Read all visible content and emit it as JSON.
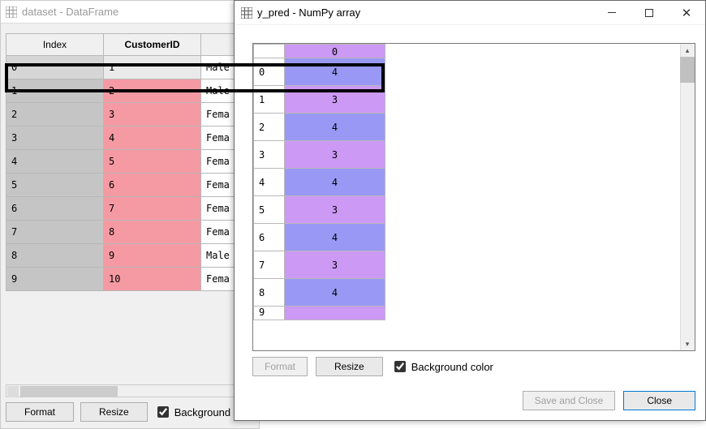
{
  "back_window": {
    "title": "dataset - DataFrame",
    "columns": {
      "index": "Index",
      "customer_id": "CustomerID"
    },
    "rows": [
      {
        "idx": "0",
        "cust": "1",
        "gender": "Male"
      },
      {
        "idx": "1",
        "cust": "2",
        "gender": "Male"
      },
      {
        "idx": "2",
        "cust": "3",
        "gender": "Fema"
      },
      {
        "idx": "3",
        "cust": "4",
        "gender": "Fema"
      },
      {
        "idx": "4",
        "cust": "5",
        "gender": "Fema"
      },
      {
        "idx": "5",
        "cust": "6",
        "gender": "Fema"
      },
      {
        "idx": "6",
        "cust": "7",
        "gender": "Fema"
      },
      {
        "idx": "7",
        "cust": "8",
        "gender": "Fema"
      },
      {
        "idx": "8",
        "cust": "9",
        "gender": "Male"
      },
      {
        "idx": "9",
        "cust": "10",
        "gender": "Fema"
      }
    ],
    "footer": {
      "format": "Format",
      "resize": "Resize",
      "bg_label": "Background"
    }
  },
  "front_window": {
    "title": "y_pred - NumPy array",
    "rows": [
      {
        "idx": "",
        "val": "0",
        "cls": "c3",
        "partial": "top"
      },
      {
        "idx": "0",
        "val": "4",
        "cls": "c4"
      },
      {
        "idx": "1",
        "val": "3",
        "cls": "c3"
      },
      {
        "idx": "2",
        "val": "4",
        "cls": "c4"
      },
      {
        "idx": "3",
        "val": "3",
        "cls": "c3"
      },
      {
        "idx": "4",
        "val": "4",
        "cls": "c4"
      },
      {
        "idx": "5",
        "val": "3",
        "cls": "c3"
      },
      {
        "idx": "6",
        "val": "4",
        "cls": "c4"
      },
      {
        "idx": "7",
        "val": "3",
        "cls": "c3"
      },
      {
        "idx": "8",
        "val": "4",
        "cls": "c4"
      },
      {
        "idx": "9",
        "val": "",
        "cls": "c3",
        "partial": "bot"
      }
    ],
    "footer": {
      "format": "Format",
      "resize": "Resize",
      "bg_label": "Background color"
    },
    "bottom": {
      "save_close": "Save and Close",
      "close": "Close"
    }
  }
}
